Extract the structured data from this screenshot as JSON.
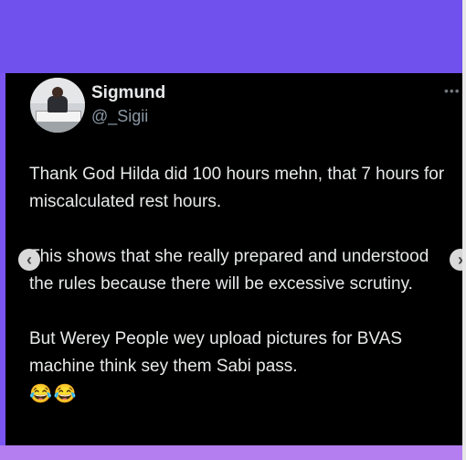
{
  "tweet": {
    "display_name": "Sigmund",
    "handle": "@_Sigii",
    "more_menu": "•••",
    "paragraphs": [
      "Thank God Hilda did 100 hours mehn, that 7 hours for miscalculated rest hours.",
      "This shows that she really prepared and understood the rules because there will be excessive scrutiny.",
      "But Werey People wey upload pictures for BVAS machine think sey them Sabi pass."
    ],
    "emojis": "😂😂"
  },
  "navigation": {
    "prev_symbol": "‹",
    "next_symbol": "›"
  },
  "colors": {
    "top_band": "#7151ee",
    "bottom_band": "#b47df0",
    "card_background": "#000000",
    "text": "#e7e9ea",
    "handle": "#8b98a5"
  }
}
